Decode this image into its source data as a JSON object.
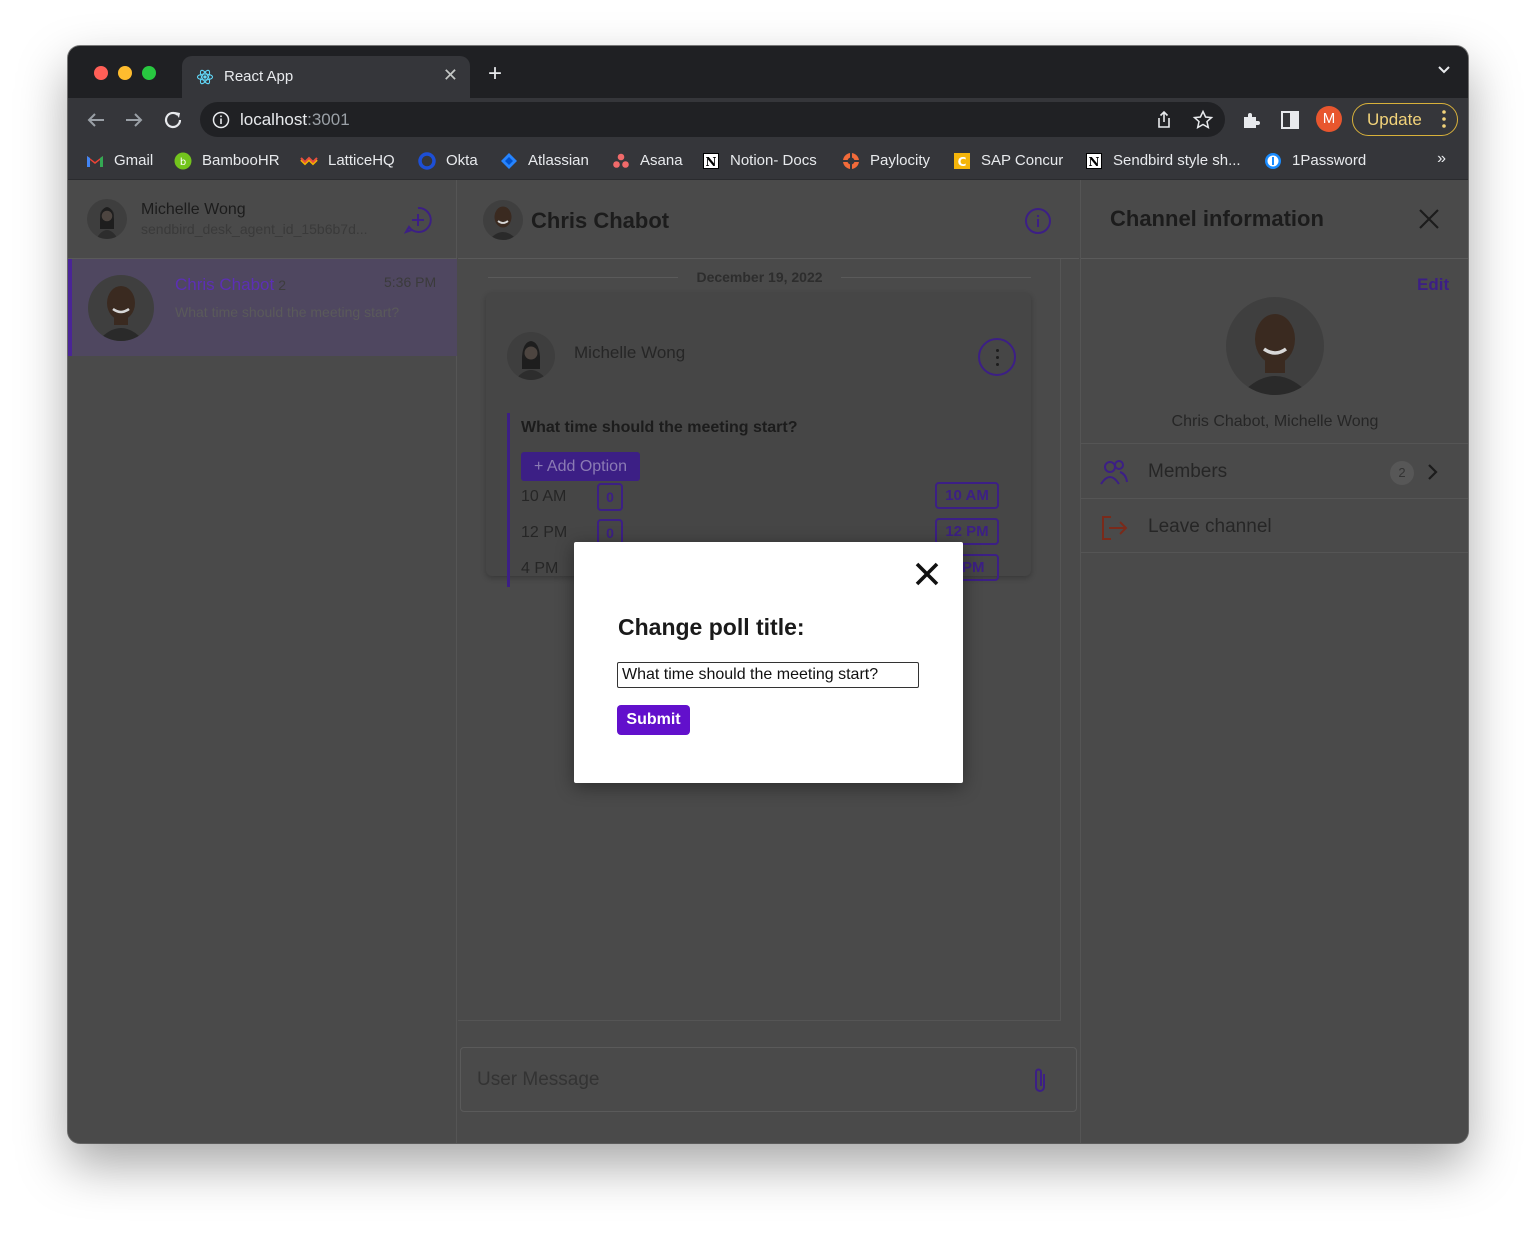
{
  "browser": {
    "tab_title": "React App",
    "url_host": "localhost",
    "url_port": ":3001",
    "profile_initial": "M",
    "update_label": "Update",
    "bookmarks": [
      "Gmail",
      "BambooHR",
      "LatticeHQ",
      "Okta",
      "Atlassian",
      "Asana",
      "Notion- Docs",
      "Paylocity",
      "SAP Concur",
      "Sendbird style sh...",
      "1Password"
    ],
    "bookmarks_more": "»"
  },
  "sidebar": {
    "user_name": "Michelle Wong",
    "user_id": "sendbird_desk_agent_id_15b6b7d...",
    "channel": {
      "name": "Chris Chabot",
      "member_count": "2",
      "time": "5:36 PM",
      "last_message": "What time should the meeting start?"
    }
  },
  "conversation": {
    "title": "Chris Chabot",
    "date_separator": "December 19, 2022",
    "message": {
      "sender": "Michelle Wong",
      "poll_title": "What time should the meeting start?",
      "add_option_label": "+ Add Option",
      "options": [
        {
          "label": "10 AM",
          "count": "0",
          "vote_label": "10 AM"
        },
        {
          "label": "12 PM",
          "count": "0",
          "vote_label": "12 PM"
        },
        {
          "label": "4 PM",
          "count": "0",
          "vote_label": "4 PM"
        }
      ]
    },
    "composer_placeholder": "User Message"
  },
  "channel_info": {
    "title": "Channel information",
    "edit_label": "Edit",
    "members_names": "Chris Chabot, Michelle Wong",
    "members_label": "Members",
    "members_count": "2",
    "leave_label": "Leave channel"
  },
  "modal": {
    "title": "Change poll title:",
    "input_value": "What time should the meeting start?",
    "submit_label": "Submit"
  },
  "colors": {
    "accent": "#6210cc",
    "dim_accent": "#3c1f85",
    "overlay": "#4a4a4a",
    "chrome_frame": "#1f2023",
    "chrome_toolbar": "#35363a"
  }
}
